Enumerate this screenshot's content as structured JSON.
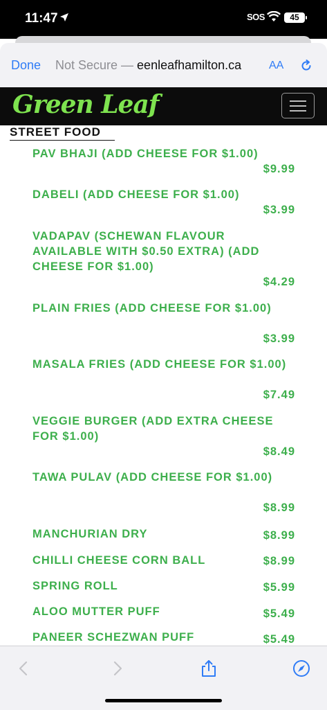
{
  "status_bar": {
    "time": "11:47",
    "sos": "SOS",
    "battery": "45"
  },
  "browser": {
    "done_label": "Done",
    "security_text": "Not Secure — ",
    "domain": "eenleafhamilton.ca",
    "text_size_label": "AA"
  },
  "site": {
    "logo_text": "Green Leaf"
  },
  "section": {
    "title": "STREET FOOD"
  },
  "menu_items": [
    {
      "name": "PAV BHAJI (ADD CHEESE FOR $1.00)",
      "price": "$9.99"
    },
    {
      "name": "DABELI (ADD CHEESE FOR $1.00)",
      "price": "$3.99"
    },
    {
      "name": "VADAPAV (SCHEWAN FLAVOUR AVAILABLE WITH $0.50 EXTRA) (ADD CHEESE FOR $1.00)",
      "price": "$4.29"
    },
    {
      "name": "PLAIN FRIES (ADD CHEESE FOR $1.00)",
      "price": "$3.99"
    },
    {
      "name": "MASALA FRIES (ADD CHEESE FOR $1.00)",
      "price": "$7.49"
    },
    {
      "name": "VEGGIE BURGER (ADD EXTRA CHEESE FOR $1.00)",
      "price": "$8.49"
    },
    {
      "name": "TAWA PULAV (ADD CHEESE FOR $1.00)",
      "price": "$8.99"
    },
    {
      "name": "MANCHURIAN DRY",
      "price": "$8.99"
    },
    {
      "name": "CHILLI CHEESE CORN BALL",
      "price": "$8.99"
    },
    {
      "name": "SPRING ROLL",
      "price": "$5.99"
    },
    {
      "name": "ALOO MUTTER PUFF",
      "price": "$5.49"
    },
    {
      "name": "PANEER SCHEZWAN PUFF",
      "price": "$5.49"
    }
  ],
  "icons": {
    "location": "location-arrow-icon",
    "wifi": "wifi-icon",
    "reload": "reload-icon",
    "back": "chevron-left-icon",
    "forward": "chevron-right-icon",
    "share": "share-icon",
    "compass": "compass-icon",
    "menu": "hamburger-menu-icon"
  },
  "colors": {
    "accent": "#2f7cf6",
    "menu_green": "#3daf4c",
    "logo_green": "#7ee34f"
  }
}
